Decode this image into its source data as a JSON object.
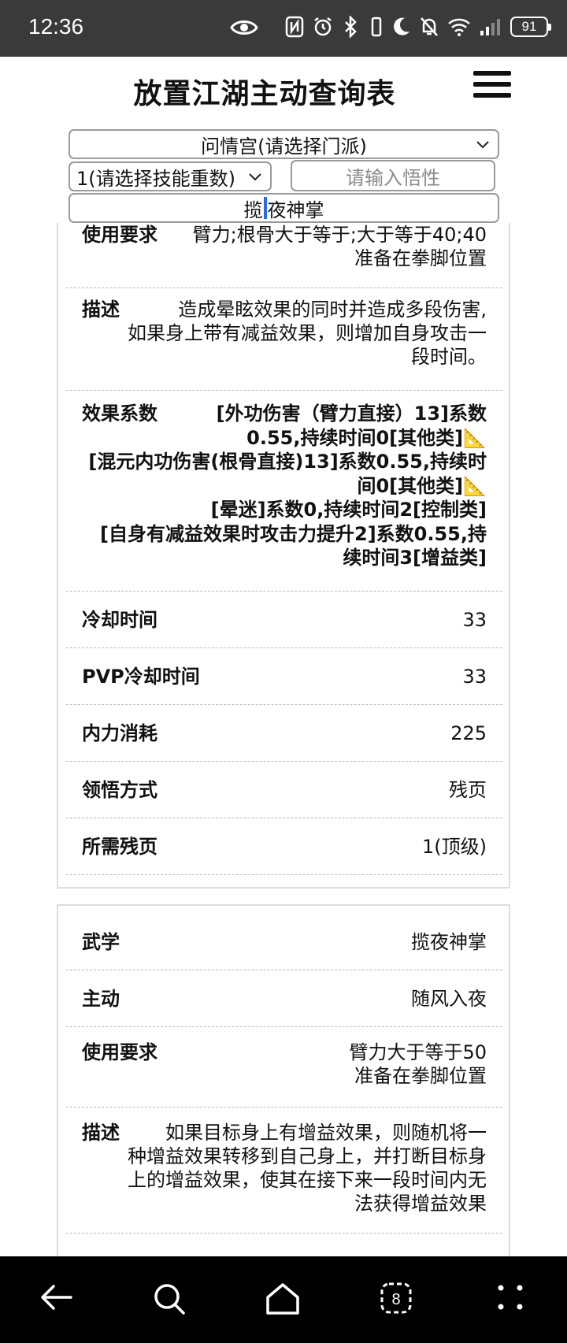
{
  "status": {
    "time": "12:36",
    "battery": "91"
  },
  "header": {
    "title": "放置江湖主动查询表"
  },
  "controls": {
    "sect_select": "问情宫(请选择门派)",
    "level_select": "1(请选择技能重数)",
    "wuxing_placeholder": "请输入悟性",
    "skill_before": "揽",
    "skill_after": "夜神掌"
  },
  "card1": {
    "requirement": {
      "label": "使用要求",
      "line1": "臂力;根骨大于等于;大于等于40;40",
      "line2": "准备在拳脚位置"
    },
    "description": {
      "label": "描述",
      "text1": "造成晕眩效果的同时并造成多段伤害,",
      "text2": "如果身上带有减益效果，则增加自身攻击一",
      "text3": "段时间。"
    },
    "effect": {
      "label": "效果系数",
      "line1": "[外功伤害（臂力直接）13]系数",
      "line2": "0.55,持续时间0[其他类]",
      "line3": "[混元内功伤害(根骨直接)13]系数0.55,持续时",
      "line4": "间0[其他类]",
      "line5": "[晕迷]系数0,持续时间2[控制类]",
      "line6": "[自身有减益效果时攻击力提升2]系数0.55,持",
      "line7": "续时间3[增益类]",
      "tri": "📐"
    },
    "cooldown": {
      "label": "冷却时间",
      "value": "33"
    },
    "pvp_cooldown": {
      "label": "PVP冷却时间",
      "value": "33"
    },
    "mp_cost": {
      "label": "内力消耗",
      "value": "225"
    },
    "learn_method": {
      "label": "领悟方式",
      "value": "残页"
    },
    "pages_needed": {
      "label": "所需残页",
      "value": "1(顶级)"
    }
  },
  "card2": {
    "skill": {
      "label": "武学",
      "value": "揽夜神掌"
    },
    "active": {
      "label": "主动",
      "value": "随风入夜"
    },
    "requirement": {
      "label": "使用要求",
      "line1": "臂力大于等于50",
      "line2": "准备在拳脚位置"
    },
    "description": {
      "label": "描述",
      "text1": "如果目标身上有增益效果，则随机将一",
      "text2": "种增益效果转移到自己身上，并打断目标身",
      "text3": "上的增益效果，使其在接下来一段时间内无",
      "text4": "法获得增益效果"
    }
  }
}
